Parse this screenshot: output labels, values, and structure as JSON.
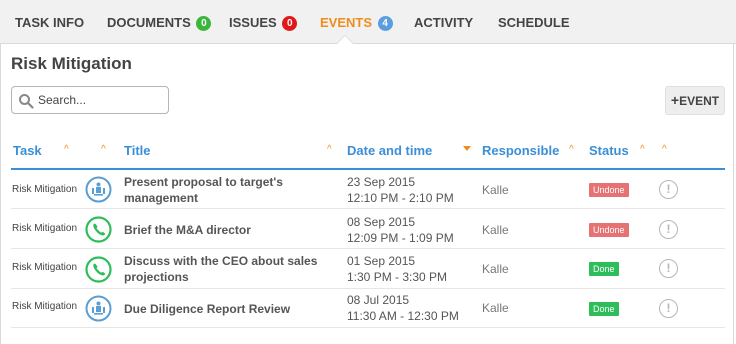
{
  "tabs": [
    {
      "label": "TASK INFO",
      "badge": null,
      "active": false
    },
    {
      "label": "DOCUMENTS",
      "badge": "0",
      "badge_color": "#3cb53c",
      "active": false
    },
    {
      "label": "ISSUES",
      "badge": "0",
      "badge_color": "#e01818",
      "active": false
    },
    {
      "label": "EVENTS",
      "badge": "4",
      "badge_color": "#5a9ee0",
      "active": true
    },
    {
      "label": "ACTIVITY",
      "badge": null,
      "active": false
    },
    {
      "label": "SCHEDULE",
      "badge": null,
      "active": false
    }
  ],
  "page": {
    "title": "Risk Mitigation"
  },
  "search": {
    "placeholder": "Search..."
  },
  "add_event": {
    "label": "EVENT",
    "icon": "plus-icon"
  },
  "table": {
    "columns": [
      "Task",
      "Title",
      "Date and time",
      "Responsible",
      "Status"
    ],
    "rows": [
      {
        "task": "Risk Mitigation",
        "type_icon": "meeting-icon",
        "title_line1": "Present proposal to target's",
        "title_line2": "management",
        "date": "23 Sep 2015",
        "time": "12:10 PM - 2:10 PM",
        "responsible": "Kalle",
        "status": "Undone"
      },
      {
        "task": "Risk Mitigation",
        "type_icon": "phone-icon",
        "title_line1": "Brief the M&A director",
        "title_line2": "",
        "date": "08 Sep 2015",
        "time": "12:09 PM - 1:09 PM",
        "responsible": "Kalle",
        "status": "Undone"
      },
      {
        "task": "Risk Mitigation",
        "type_icon": "phone-icon",
        "title_line1": "Discuss with the CEO about sales",
        "title_line2": "projections",
        "date": "01 Sep 2015",
        "time": "1:30 PM - 3:30 PM",
        "responsible": "Kalle",
        "status": "Done"
      },
      {
        "task": "Risk Mitigation",
        "type_icon": "meeting-icon",
        "title_line1": "Due Diligence Report Review",
        "title_line2": "",
        "date": "08 Jul 2015",
        "time": "11:30 AM - 12:30 PM",
        "responsible": "Kalle",
        "status": "Done"
      }
    ]
  },
  "colors": {
    "accent": "#f08c1c",
    "link": "#3a8fd6",
    "undone": "#e57373",
    "done": "#2ebd5a"
  }
}
